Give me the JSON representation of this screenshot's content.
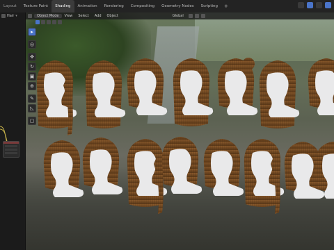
{
  "topbar": {
    "tabs": [
      {
        "label": "Layout"
      },
      {
        "label": "Texture Paint"
      },
      {
        "label": "Shading",
        "active": true
      },
      {
        "label": "Animation"
      },
      {
        "label": "Rendering"
      },
      {
        "label": "Compositing"
      },
      {
        "label": "Geometry Nodes"
      },
      {
        "label": "Scripting"
      }
    ],
    "add_tab": "+"
  },
  "left_panel": {
    "object_name": "Hair"
  },
  "viewport_header": {
    "orientation": "Global",
    "mode": "Object Mode",
    "menus": [
      "View",
      "Select",
      "Add",
      "Object"
    ]
  },
  "toolbar": {
    "tools": [
      {
        "name": "select-tool",
        "glyph": "▸",
        "active": true
      },
      {
        "name": "cursor-tool",
        "glyph": "◎"
      },
      {
        "name": "move-tool",
        "glyph": "✥"
      },
      {
        "name": "rotate-tool",
        "glyph": "↻"
      },
      {
        "name": "scale-tool",
        "glyph": "▣"
      },
      {
        "name": "transform-tool",
        "glyph": "⊕"
      },
      {
        "name": "annotate-tool",
        "glyph": "✎"
      },
      {
        "name": "measure-tool",
        "glyph": "◺"
      },
      {
        "name": "add-cube-tool",
        "glyph": "▢"
      }
    ]
  },
  "scene": {
    "heads": [
      {
        "style": "ponytail"
      },
      {
        "style": "long-straight"
      },
      {
        "style": "bob"
      },
      {
        "style": "long-layered"
      },
      {
        "style": "bun"
      },
      {
        "style": "long-straight"
      },
      {
        "style": "bob"
      },
      {
        "style": "short-bob"
      },
      {
        "style": "lob"
      },
      {
        "style": "long-braid"
      },
      {
        "style": "side-part"
      },
      {
        "style": "bob-fringe"
      },
      {
        "style": "low-ponytail"
      },
      {
        "style": "short-bob"
      },
      {
        "style": "bob"
      }
    ],
    "colors": {
      "hair": "#6b4420",
      "hair_light": "#8a5a2c",
      "head": "#e9e9ea"
    }
  }
}
